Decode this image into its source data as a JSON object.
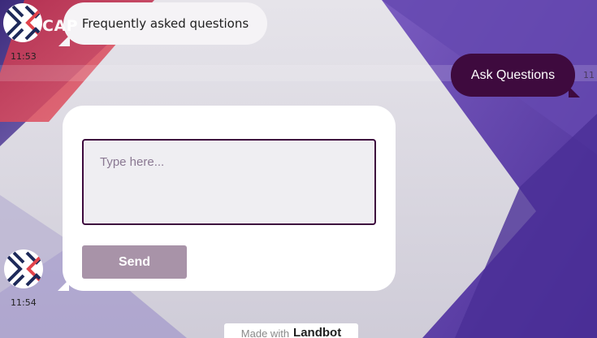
{
  "chat": {
    "brand_overlay": "CAP",
    "bot_message": "Frequently asked questions",
    "bot_time_1": "11:53",
    "user_message": "Ask Questions",
    "user_time": "11",
    "bot_time_2": "11:54"
  },
  "input": {
    "placeholder": "Type here...",
    "send_label": "Send"
  },
  "footer": {
    "made_with": "Made with",
    "brand": "Landbot"
  },
  "colors": {
    "accent": "#3e0a3e",
    "send_button": "#a893a8",
    "bg_purple": "#5a3ea0",
    "bg_red": "#d8424c"
  },
  "icons": {
    "avatar": "logo-chevrons-icon"
  }
}
